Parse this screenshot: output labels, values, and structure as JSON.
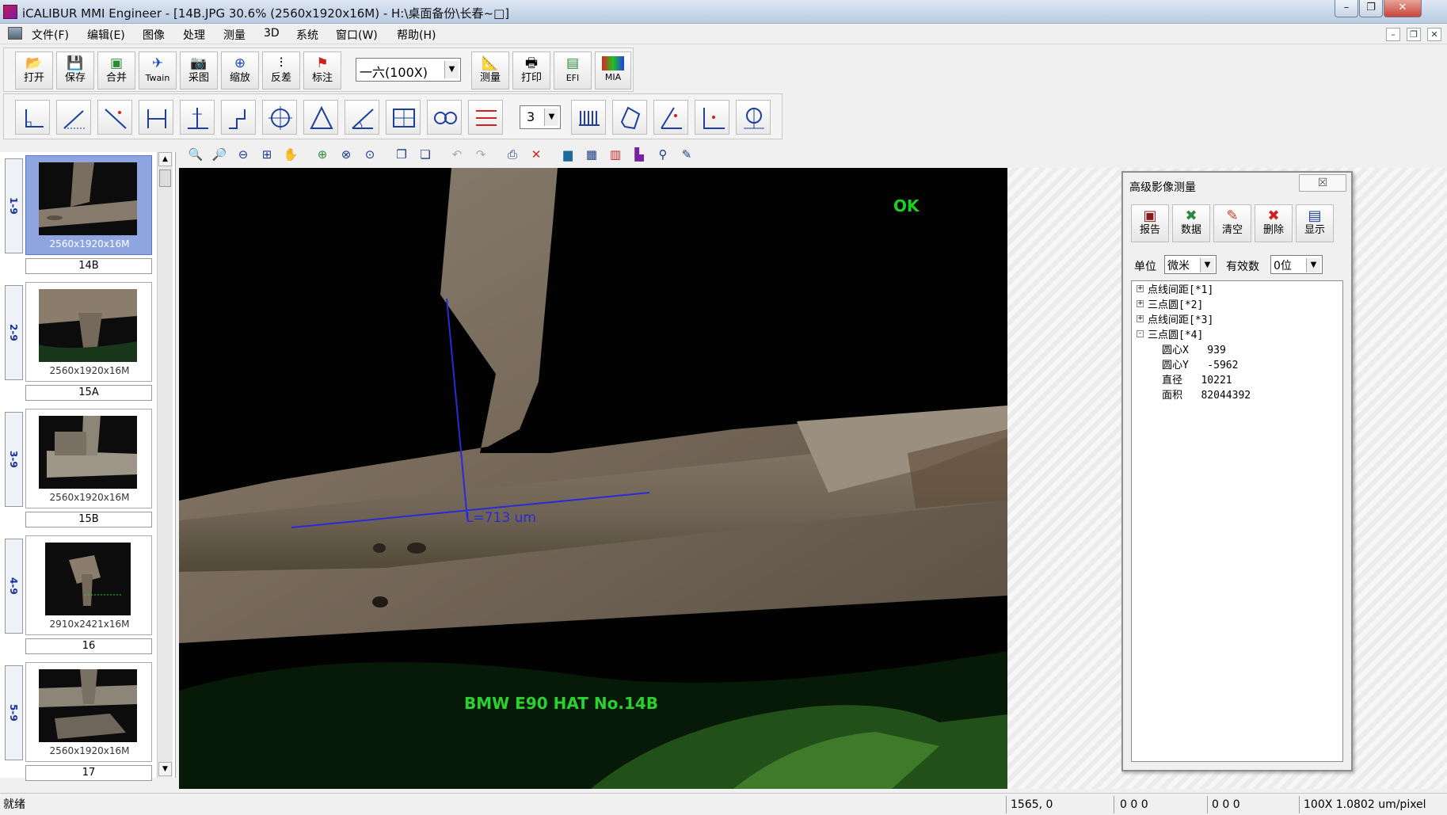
{
  "window": {
    "title": "iCALIBUR MMI Engineer - [14B.JPG 30.6% (2560x1920x16M) - H:\\桌面备份\\长春~□]",
    "min_label": "–",
    "max_label": "❐",
    "close_label": "✕"
  },
  "menu": {
    "items": [
      "文件(F)",
      "编辑(E)",
      "图像",
      "处理",
      "测量",
      "3D",
      "系统",
      "窗口(W)",
      "帮助(H)"
    ],
    "mdi_min": "–",
    "mdi_restore": "❐",
    "mdi_close": "✕"
  },
  "toolbar1": {
    "buttons": [
      {
        "label": "打开",
        "icon": "open-folder-icon"
      },
      {
        "label": "保存",
        "icon": "save-disk-icon"
      },
      {
        "label": "合并",
        "icon": "merge-icon"
      },
      {
        "label": "Twain",
        "icon": "twain-icon"
      },
      {
        "label": "采图",
        "icon": "capture-camera-icon"
      },
      {
        "label": "缩放",
        "icon": "zoom-icon"
      },
      {
        "label": "反差",
        "icon": "contrast-icon"
      },
      {
        "label": "标注",
        "icon": "flag-annotate-icon"
      }
    ],
    "zoom_select": "一六(100X)",
    "buttons2": [
      {
        "label": "测量",
        "icon": "measure-icon"
      },
      {
        "label": "打印",
        "icon": "print-icon"
      },
      {
        "label": "EFI",
        "icon": "efi-icon"
      },
      {
        "label": "MIA",
        "icon": "mia-icon"
      }
    ]
  },
  "toolbar2": {
    "number_select": "3"
  },
  "thumbnails": [
    {
      "tab": "1-9",
      "dims": "2560x1920x16M",
      "name": "14B",
      "selected": true
    },
    {
      "tab": "2-9",
      "dims": "2560x1920x16M",
      "name": "15A",
      "selected": false
    },
    {
      "tab": "3-9",
      "dims": "2560x1920x16M",
      "name": "15B",
      "selected": false
    },
    {
      "tab": "4-9",
      "dims": "2910x2421x16M",
      "name": "16",
      "selected": false
    },
    {
      "tab": "5-9",
      "dims": "2560x1920x16M",
      "name": "17",
      "selected": false
    }
  ],
  "image": {
    "ok_text": "OK",
    "caption": "BMW E90 HAT No.14B",
    "measurement": "L=713  um"
  },
  "panel": {
    "title": "高级影像测量",
    "close": "☒",
    "buttons": [
      {
        "label": "报告",
        "icon": "report-icon"
      },
      {
        "label": "数据",
        "icon": "data-x-icon"
      },
      {
        "label": "清空",
        "icon": "clear-icon"
      },
      {
        "label": "删除",
        "icon": "delete-x-icon"
      },
      {
        "label": "显示",
        "icon": "display-icon"
      }
    ],
    "unit_label": "单位",
    "unit_value": "微米",
    "digits_label": "有效数",
    "digits_value": "0位",
    "tree": {
      "nodes": [
        {
          "box": "+",
          "text": "点线间距[*1]"
        },
        {
          "box": "+",
          "text": "三点圆[*2]"
        },
        {
          "box": "+",
          "text": "点线间距[*3]"
        },
        {
          "box": "-",
          "text": "三点圆[*4]"
        }
      ],
      "children": [
        {
          "text": "圆心X   939"
        },
        {
          "text": "圆心Y   -5962"
        },
        {
          "text": "直径   10221"
        },
        {
          "text": "面积   82044392"
        }
      ]
    }
  },
  "status": {
    "ready": "就绪",
    "coords": "1565, 0",
    "rgb1": "0 0 0",
    "rgb2": "0 0 0",
    "scale": "100X   1.0802  um/pixel"
  }
}
